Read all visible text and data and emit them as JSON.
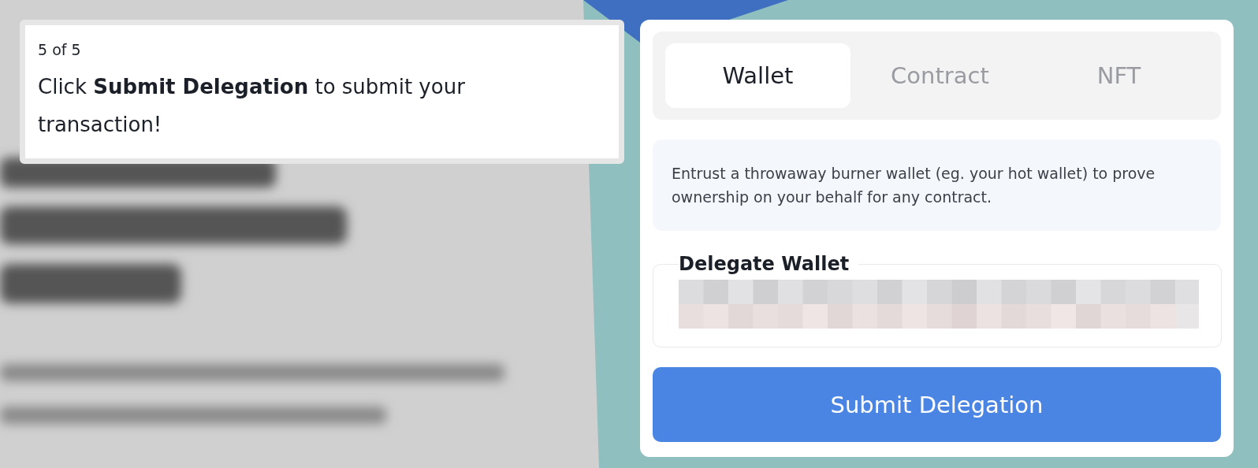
{
  "tooltip": {
    "step": "5 of 5",
    "message": "Click **Submit Delegation** to submit your transaction!"
  },
  "tabs": [
    {
      "label": "Wallet",
      "selected": true
    },
    {
      "label": "Contract",
      "selected": false
    },
    {
      "label": "NFT",
      "selected": false
    }
  ],
  "info": "Entrust a throwaway burner wallet (eg. your hot wallet) to prove ownership on your behalf for any contract.",
  "field": {
    "label": "Delegate Wallet"
  },
  "button": "Submit Delegation"
}
